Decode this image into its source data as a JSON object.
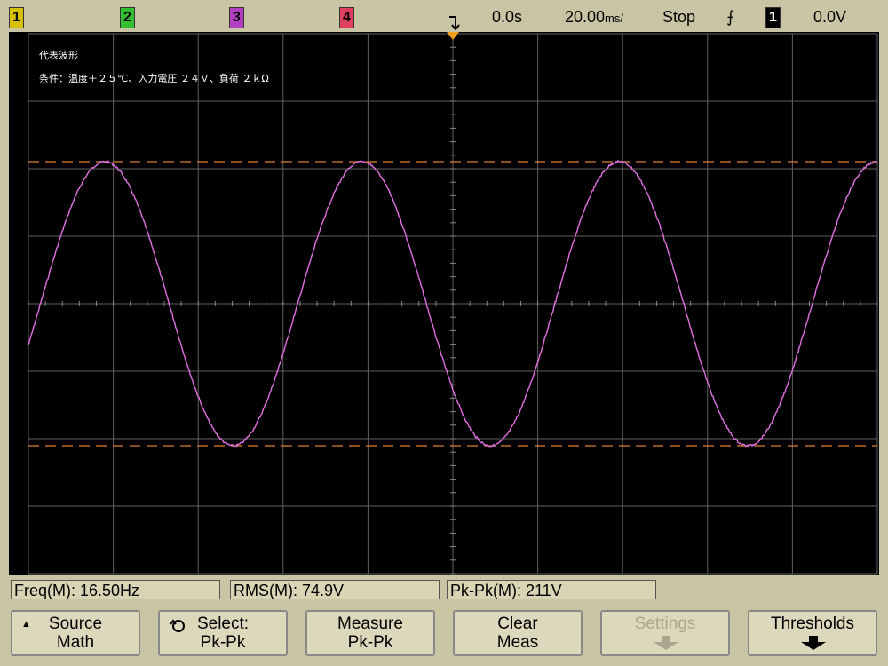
{
  "top": {
    "channels": [
      {
        "label": "1",
        "color": "#d8c000"
      },
      {
        "label": "2",
        "color": "#30c030"
      },
      {
        "label": "3",
        "color": "#b040c0"
      },
      {
        "label": "4",
        "color": "#e04060"
      }
    ],
    "delay": "0.0s",
    "timebase": "20.00",
    "timebase_unit": "ms/",
    "run_state": "Stop",
    "trigger_slope_symbol": "⨍",
    "trigger_source": "1",
    "trigger_level": "0.0V"
  },
  "screen": {
    "title": "代表波形",
    "conditions": "条件：温度＋２５℃、入力電圧 ２４Ｖ、負荷 ２ｋΩ"
  },
  "measurements": {
    "freq": "Freq(M): 16.50Hz",
    "rms": "RMS(M): 74.9V",
    "pkpk": "Pk-Pk(M): 211V"
  },
  "softkeys": [
    {
      "line1": "Source",
      "line2": "Math",
      "enabled": true
    },
    {
      "line1": "Select:",
      "line2": "Pk-Pk",
      "enabled": true
    },
    {
      "line1": "Measure",
      "line2": "Pk-Pk",
      "enabled": true
    },
    {
      "line1": "Clear",
      "line2": "Meas",
      "enabled": true
    },
    {
      "line1": "Settings",
      "line2": "",
      "enabled": false
    },
    {
      "line1": "Thresholds",
      "line2": "",
      "enabled": true
    }
  ],
  "waveform": {
    "frequency_hz": 16.5,
    "peak_to_peak_v": 211,
    "rms_v": 74.9,
    "time_per_div_ms": 20,
    "trace_color": "#e070e0",
    "cursor_color": "#e08030"
  },
  "colors": {
    "bezel": "#c8c4a4",
    "screen": "#000000",
    "grid": "#606060"
  }
}
